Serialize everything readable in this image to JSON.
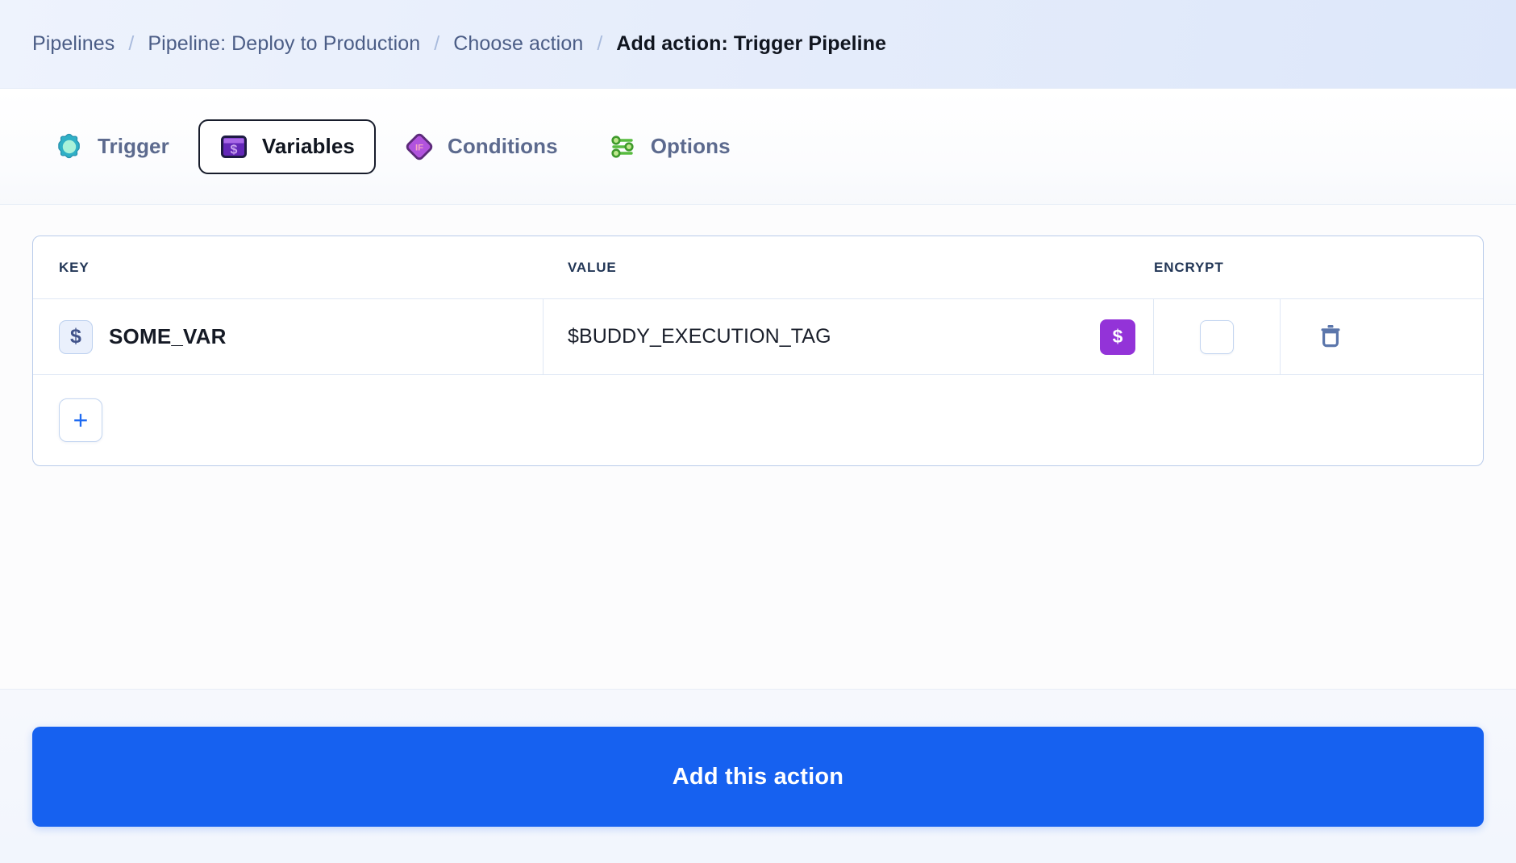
{
  "breadcrumb": {
    "separator": "/",
    "items": [
      {
        "label": "Pipelines",
        "current": false
      },
      {
        "label": "Pipeline: Deploy to Production",
        "current": false
      },
      {
        "label": "Choose action",
        "current": false
      },
      {
        "label": "Add action: Trigger Pipeline",
        "current": true
      }
    ]
  },
  "tabs": [
    {
      "label": "Trigger",
      "icon": "gear-icon",
      "active": false
    },
    {
      "label": "Variables",
      "icon": "variable-icon",
      "active": true
    },
    {
      "label": "Conditions",
      "icon": "if-diamond-icon",
      "active": false
    },
    {
      "label": "Options",
      "icon": "sliders-icon",
      "active": false
    }
  ],
  "variables_table": {
    "columns": [
      "KEY",
      "VALUE",
      "ENCRYPT"
    ],
    "rows": [
      {
        "key_icon": "dollar-badge-icon",
        "key": "SOME_VAR",
        "value": "$BUDDY_EXECUTION_TAG",
        "value_button_label": "$",
        "encrypt": false,
        "delete_icon": "trash-icon"
      }
    ],
    "add_row_label": "+"
  },
  "footer": {
    "submit_label": "Add this action"
  },
  "colors": {
    "primary_blue": "#1661f0",
    "variable_purple": "#9333d8",
    "trigger_teal": "#2aa7bf",
    "conditions_purple": "#a855d6",
    "options_green": "#4caf3e",
    "border_blue": "#b9cbea",
    "breadcrumb_text": "#4b5d86"
  }
}
